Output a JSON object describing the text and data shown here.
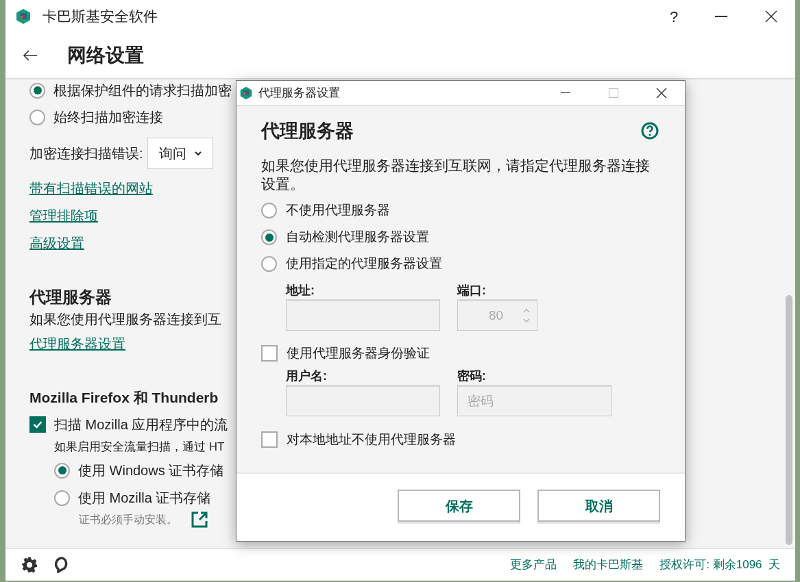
{
  "app": {
    "title": "卡巴斯基安全软件",
    "help": "?",
    "page_title": "网络设置"
  },
  "main": {
    "scan_options": [
      {
        "label": "根据保护组件的请求扫描加密",
        "selected": true
      },
      {
        "label": "始终扫描加密连接",
        "selected": false
      }
    ],
    "error_label": "加密连接扫描错误:",
    "error_value": "询问",
    "links": [
      "带有扫描错误的网站",
      "管理排除项",
      "高级设置"
    ],
    "proxy": {
      "heading": "代理服务器",
      "description": "如果您使用代理服务器连接到互",
      "link": "代理服务器设置"
    },
    "mozilla": {
      "heading": "Mozilla Firefox 和 Thunderb",
      "scan": {
        "label": "扫描 Mozilla 应用程序中的流",
        "checked": true
      },
      "description": "如果启用安全流量扫描，通过 HT",
      "cert_options": [
        {
          "label": "使用 Windows 证书存储",
          "selected": true
        },
        {
          "label": "使用 Mozilla 证书存储",
          "selected": false
        }
      ],
      "note": "证书必须手动安装。"
    }
  },
  "footer": {
    "links": [
      "更多产品",
      "我的卡巴斯基",
      "授权许可: 剩余1096  天"
    ]
  },
  "dialog": {
    "title": "代理服务器设置",
    "heading": "代理服务器",
    "description": "如果您使用代理服务器连接到互联网，请指定代理服务器连接设置。",
    "options": [
      {
        "label": "不使用代理服务器",
        "selected": false
      },
      {
        "label": "自动检测代理服务器设置",
        "selected": true
      },
      {
        "label": "使用指定的代理服务器设置",
        "selected": false
      }
    ],
    "address_label": "地址:",
    "port_label": "端口:",
    "port_value": "80",
    "auth": {
      "label": "使用代理服务器身份验证",
      "checked": false
    },
    "username_label": "用户名:",
    "password_label": "密码:",
    "password_placeholder": "密码",
    "local": {
      "label": "对本地地址不使用代理服务器",
      "checked": false
    },
    "buttons": [
      "保存",
      "取消"
    ]
  }
}
